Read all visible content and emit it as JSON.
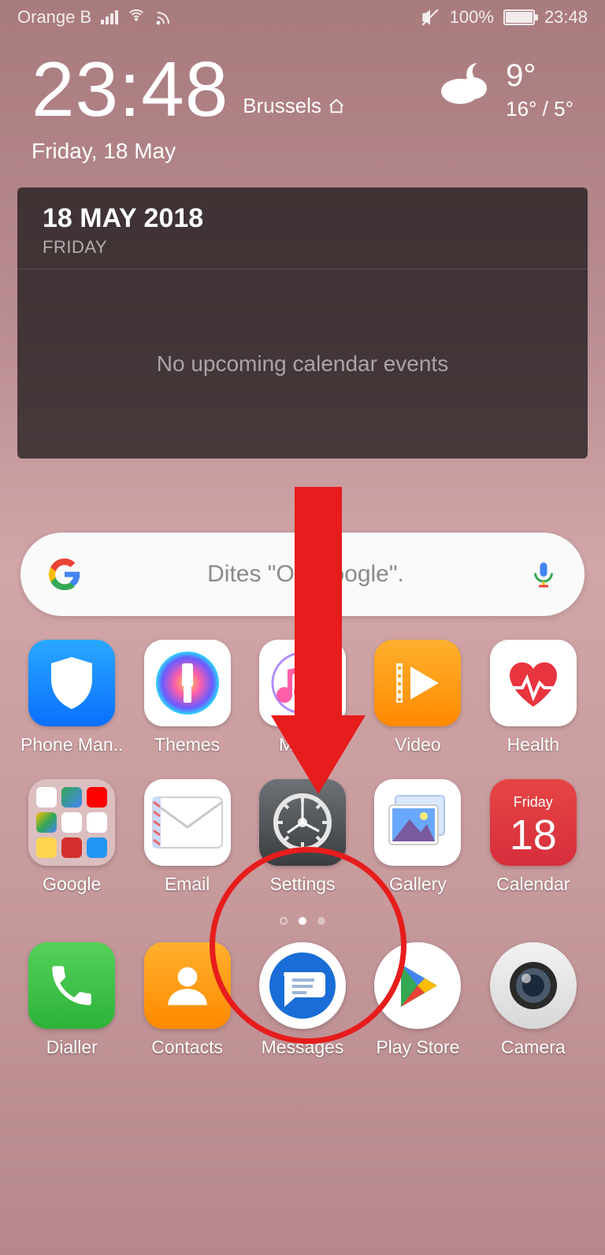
{
  "status": {
    "carrier": "Orange B",
    "battery_pct": "100%",
    "clock": "23:48"
  },
  "clock_widget": {
    "time": "23:48",
    "city": "Brussels",
    "date": "Friday, 18 May"
  },
  "weather": {
    "temp": "9°",
    "range": "16° / 5°"
  },
  "calendar_widget": {
    "date": "18 MAY 2018",
    "day": "FRIDAY",
    "empty_text": "No upcoming calendar events"
  },
  "search": {
    "placeholder": "Dites \"Ok Google\"."
  },
  "apps_row1": [
    {
      "label": "Phone Man.."
    },
    {
      "label": "Themes"
    },
    {
      "label": "Music"
    },
    {
      "label": "Video"
    },
    {
      "label": "Health"
    }
  ],
  "apps_row2": [
    {
      "label": "Google"
    },
    {
      "label": "Email"
    },
    {
      "label": "Settings"
    },
    {
      "label": "Gallery"
    },
    {
      "label": "Calendar"
    }
  ],
  "calendar_icon": {
    "dow": "Friday",
    "num": "18"
  },
  "dock": [
    {
      "label": "Dialler"
    },
    {
      "label": "Contacts"
    },
    {
      "label": "Messages"
    },
    {
      "label": "Play Store"
    },
    {
      "label": "Camera"
    }
  ]
}
